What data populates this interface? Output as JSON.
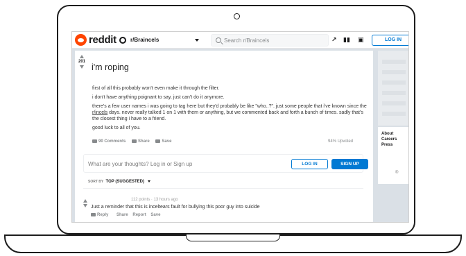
{
  "header": {
    "brand": "reddit",
    "subreddit": "r/Braincels",
    "search_placeholder": "Search r/Braincels",
    "trending_icon": "trending-icon",
    "stats_icon": "stats-icon",
    "chat_icon": "chat-icon",
    "login_label": "LOG IN"
  },
  "post": {
    "votes": "201",
    "title": "i'm roping",
    "body": {
      "p1": "first of all this probably won't even make it through the filter.",
      "p2": "i don't have anything poignant to say, just can't do it anymore.",
      "p3a": "there's a few user names i was going to tag here but they'd probably be like \"who..?\". just some people that i've known since the ",
      "p3_link": "r/incels",
      "p3b": " days. never really talked 1 on 1 with them or anything, but we commented back and forth a bunch of times. sadly that's the closest thing i have to a friend.",
      "p4": "good luck to all of you."
    },
    "comments_label": "90 Comments",
    "share_label": "Share",
    "save_label": "Save",
    "upvoted": "94% Upvoted"
  },
  "comment_box": {
    "prompt": "What are your thoughts? Log in or Sign up",
    "login": "LOG IN",
    "signup": "SIGN UP"
  },
  "sort": {
    "label": "SORT BY",
    "value": "TOP (SUGGESTED)"
  },
  "comment": {
    "meta": "112 points · 13 hours ago",
    "text": "Just a reminder that this is inceltears fault for bullying this poor guy into suicide",
    "reply": "Reply",
    "share": "Share",
    "report": "Report",
    "save": "Save"
  },
  "sidebar": {
    "links": [
      "About",
      "Careers",
      "Press"
    ],
    "dot": "®"
  }
}
